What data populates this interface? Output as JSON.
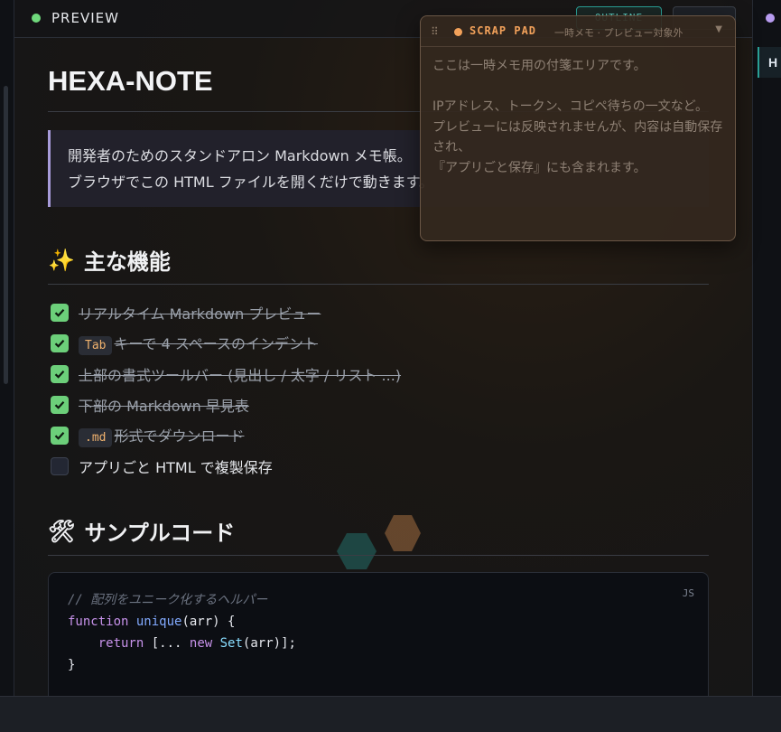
{
  "header": {
    "title": "PREVIEW",
    "outline_button": "OUTLINE",
    "status_color": "#6fd97c"
  },
  "document": {
    "title": "HEXA-NOTE",
    "callout_lines": [
      "開発者のためのスタンドアロン Markdown メモ帳。",
      "ブラウザでこの HTML ファイルを開くだけで動きます。"
    ],
    "features": {
      "icon": "✨",
      "heading": "主な機能",
      "items": [
        {
          "code": "",
          "text": "リアルタイム Markdown プレビュー",
          "checked": true
        },
        {
          "code": "Tab",
          "text": "キーで 4 スペースのインデント",
          "checked": true
        },
        {
          "code": "",
          "text": "上部の書式ツールバー (見出し / 太字 / リスト ...)",
          "checked": true
        },
        {
          "code": "",
          "text": "下部の Markdown 早見表",
          "checked": true
        },
        {
          "code": ".md",
          "text": "形式でダウンロード",
          "checked": true
        },
        {
          "code": "",
          "text": "アプリごと HTML で複製保存",
          "checked": false
        }
      ]
    },
    "sample": {
      "icon": "🛠",
      "heading": "サンプルコード",
      "lang": "JS",
      "comment": "// 配列をユニーク化するヘルパー",
      "kw_function": "function",
      "fn_name": "unique",
      "params": "(arr) {",
      "kw_return": "return",
      "spread_open": " [...",
      "kw_new": "new",
      "type_set": "Set",
      "args_close": "(arr)];",
      "close_brace": "}"
    }
  },
  "scrap_pad": {
    "title": "SCRAP PAD",
    "subtitle": "一時メモ · プレビュー対象外",
    "body": "ここは一時メモ用の付箋エリアです。\n\nIPアドレス、トークン、コピペ待ちの一文など。\nプレビューには反映されませんが、内容は自動保存され、\n『アプリごと保存』にも含まれます。"
  },
  "outline": {
    "active_item": "H"
  }
}
